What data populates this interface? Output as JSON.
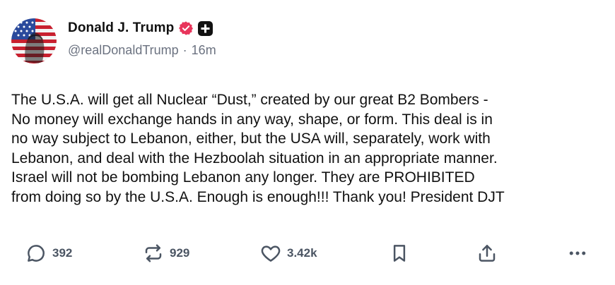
{
  "post": {
    "author": {
      "display_name": "Donald J. Trump",
      "handle": "@realDonaldTrump",
      "separator": "·",
      "time_ago": "16m",
      "badges": [
        "verified-badge-icon",
        "plus-badge-icon"
      ]
    },
    "text": "The U.S.A. will get all Nuclear “Dust,” created by our great B2 Bombers -\nNo money will exchange hands in any way, shape, or form. This deal is in\nno way subject to Lebanon, either, but the USA will, separately, work with\nLebanon, and deal with the Hezboolah situation in an appropriate manner.\nIsrael will not be bombing Lebanon any longer. They are PROHIBITED\nfrom doing so by the U.S.A. Enough is enough!!! Thank you! President DJT",
    "actions": {
      "replies": {
        "icon": "reply-bubble-icon",
        "count": "392"
      },
      "retruths": {
        "icon": "repost-arrows-icon",
        "count": "929"
      },
      "likes": {
        "icon": "heart-icon",
        "count": "3.42k"
      },
      "bookmark": {
        "icon": "bookmark-icon"
      },
      "share": {
        "icon": "share-upload-icon"
      },
      "more": {
        "icon": "more-dots-icon"
      }
    }
  },
  "colors": {
    "text": "#111111",
    "muted": "#6b7280",
    "icon": "#4b5563",
    "verified": "#e8355b"
  }
}
